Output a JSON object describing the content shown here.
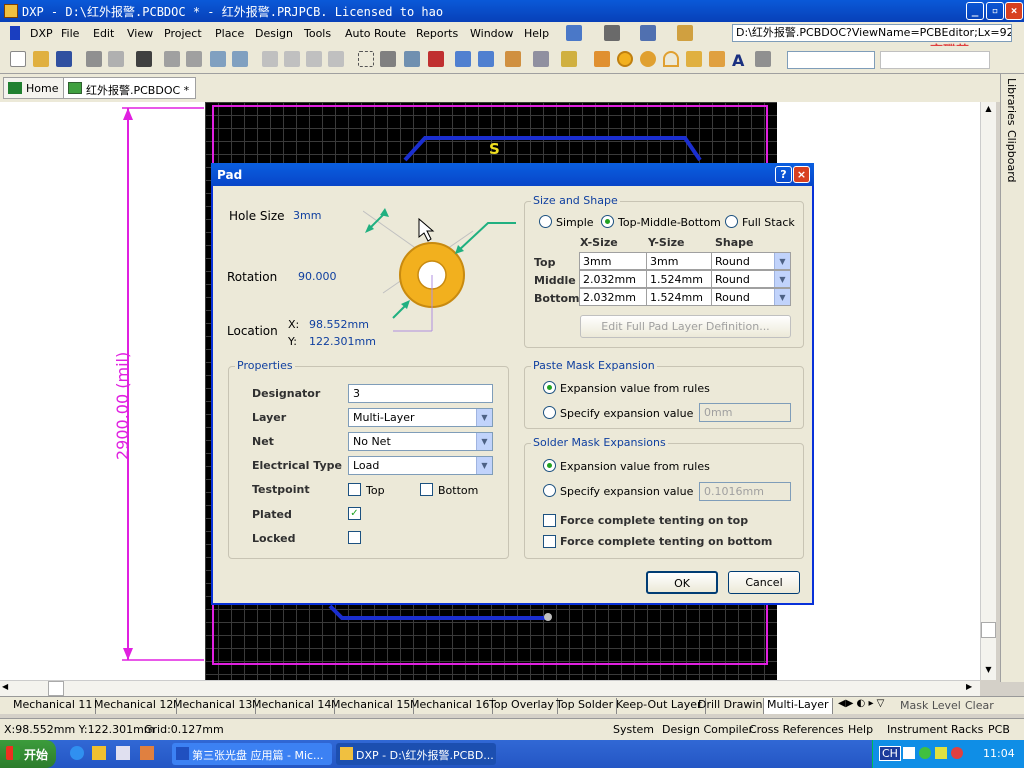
{
  "window": {
    "title": "DXP - D:\\红外报警.PCBDOC * - 红外报警.PRJPCB. Licensed to hao",
    "minimize": "_",
    "maximize": "▫",
    "close": "×"
  },
  "menu": [
    "DXP",
    "File",
    "Edit",
    "View",
    "Project",
    "Place",
    "Design",
    "Tools",
    "Auto Route",
    "Reports",
    "Window",
    "Help"
  ],
  "address": "D:\\红外报警.PCBDOC?ViewName=PCBEditor;Lx=927(",
  "brand_text": "育碟苑",
  "tabs": [
    "Home",
    "红外报警.PCBDOC *"
  ],
  "right_panel": [
    "Libraries",
    "Clipboard"
  ],
  "canvas": {
    "dimension_label": "2900.00 (mil)",
    "silk_text": "S"
  },
  "dialog": {
    "title": "Pad",
    "help": "?",
    "close": "×",
    "hole_size_label": "Hole Size",
    "hole_size_value": "3mm",
    "rotation_label": "Rotation",
    "rotation_value": "90.000",
    "location_label": "Location",
    "loc_x_label": "X:",
    "loc_x_value": "98.552mm",
    "loc_y_label": "Y:",
    "loc_y_value": "122.301mm",
    "size_shape": {
      "title": "Size and Shape",
      "options": [
        "Simple",
        "Top-Middle-Bottom",
        "Full Stack"
      ],
      "selected": "Top-Middle-Bottom",
      "headers": [
        "X-Size",
        "Y-Size",
        "Shape"
      ],
      "rows": [
        {
          "name": "Top",
          "x": "3mm",
          "y": "3mm",
          "shape": "Round"
        },
        {
          "name": "Middle",
          "x": "2.032mm",
          "y": "1.524mm",
          "shape": "Round"
        },
        {
          "name": "Bottom",
          "x": "2.032mm",
          "y": "1.524mm",
          "shape": "Round"
        }
      ],
      "edit_button": "Edit Full Pad Layer Definition..."
    },
    "properties": {
      "title": "Properties",
      "designator_label": "Designator",
      "designator_value": "3",
      "layer_label": "Layer",
      "layer_value": "Multi-Layer",
      "net_label": "Net",
      "net_value": "No Net",
      "etype_label": "Electrical Type",
      "etype_value": "Load",
      "testpoint_label": "Testpoint",
      "tp_top": "Top",
      "tp_bottom": "Bottom",
      "plated_label": "Plated",
      "plated": true,
      "locked_label": "Locked",
      "locked": false
    },
    "paste_mask": {
      "title": "Paste Mask Expansion",
      "opt_rules": "Expansion value from rules",
      "opt_specify": "Specify expansion value",
      "value": "0mm"
    },
    "solder_mask": {
      "title": "Solder Mask Expansions",
      "opt_rules": "Expansion value from rules",
      "opt_specify": "Specify expansion value",
      "value": "0.1016mm",
      "force_top": "Force complete tenting on top",
      "force_bottom": "Force complete tenting on bottom"
    },
    "ok": "OK",
    "cancel": "Cancel"
  },
  "layer_tabs": [
    "Mechanical 11",
    "Mechanical 12",
    "Mechanical 13",
    "Mechanical 14",
    "Mechanical 15",
    "Mechanical 16",
    "Top Overlay",
    "Top Solder",
    "Keep-Out Layer",
    "Drill Drawing",
    "Multi-Layer"
  ],
  "layer_controls": {
    "mask_level": "Mask Level",
    "clear": "Clear"
  },
  "status": {
    "coords": "X:98.552mm Y:122.301mm",
    "grid": "Grid:0.127mm",
    "panels": [
      "System",
      "Design Compiler",
      "Cross References",
      "Help",
      "Instrument Racks",
      "PCB"
    ]
  },
  "taskbar": {
    "start": "开始",
    "tasks": [
      "第三张光盘 应用篇 - Mic...",
      "DXP - D:\\红外报警.PCBD..."
    ],
    "ime": "CH",
    "clock": "11:04"
  },
  "colors": {
    "accent": "#0a59d8",
    "pad": "#f2b01e",
    "board": "#000000",
    "magenta": "#e020e0",
    "trace": "#1a2ed0"
  }
}
